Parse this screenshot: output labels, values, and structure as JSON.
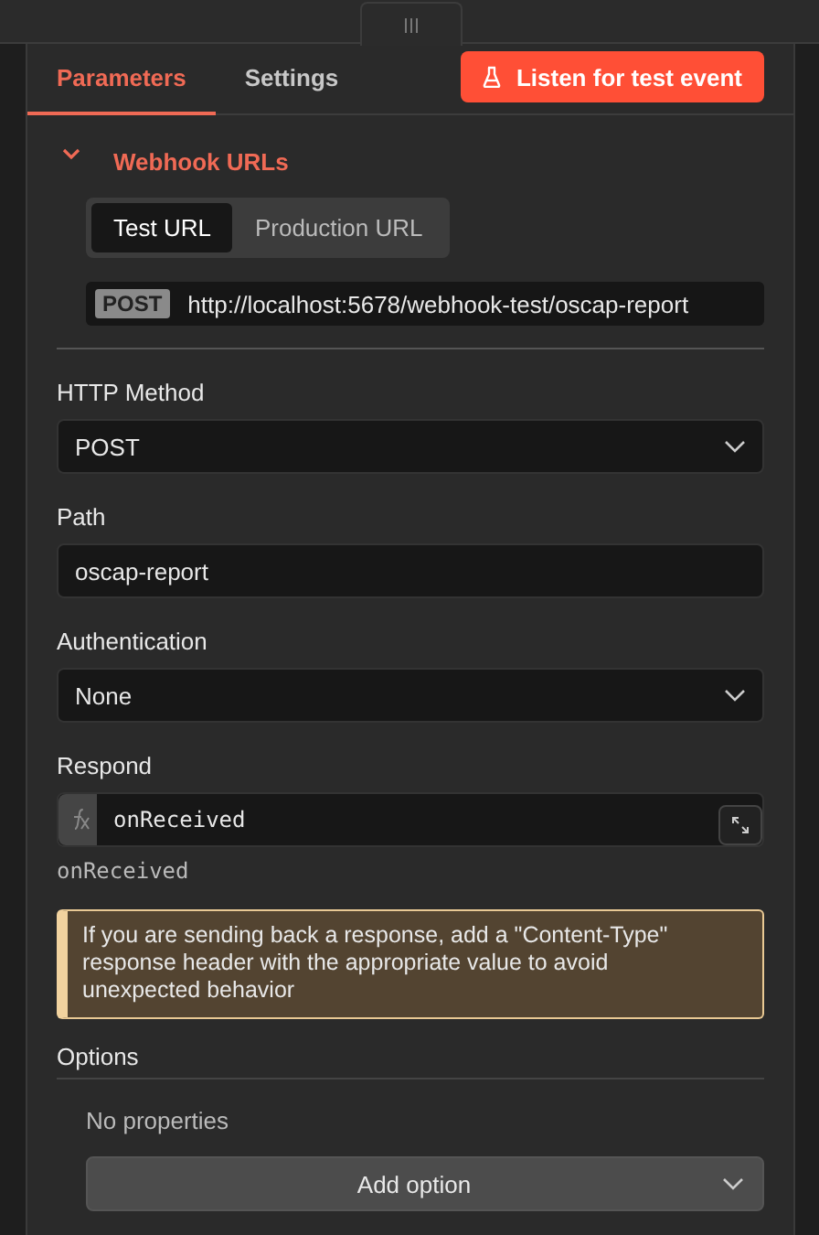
{
  "tabs": [
    {
      "label": "Parameters",
      "selected": true
    },
    {
      "label": "Settings",
      "selected": false
    }
  ],
  "listen_button": "Listen for test event",
  "webhook_urls": {
    "title": "Webhook URLs",
    "expanded": true,
    "url_tabs": [
      {
        "label": "Test URL",
        "selected": true
      },
      {
        "label": "Production URL",
        "selected": false
      }
    ],
    "method": "POST",
    "url": "http://localhost:5678/webhook-test/oscap-report"
  },
  "fields": [
    {
      "kind": "select",
      "label": "HTTP Method",
      "value": "POST"
    },
    {
      "kind": "text",
      "label": "Path",
      "value": "oscap-report"
    },
    {
      "kind": "select",
      "label": "Authentication",
      "value": "None"
    },
    {
      "kind": "expression",
      "label": "Respond",
      "value": "onReceived",
      "result": "onReceived"
    }
  ],
  "notice": "If you are sending back a response, add a \"Content-Type\" response header with the appropriate value to avoid unexpected behavior",
  "options": {
    "title": "Options",
    "empty_text": "No properties",
    "add_button": "Add option"
  }
}
